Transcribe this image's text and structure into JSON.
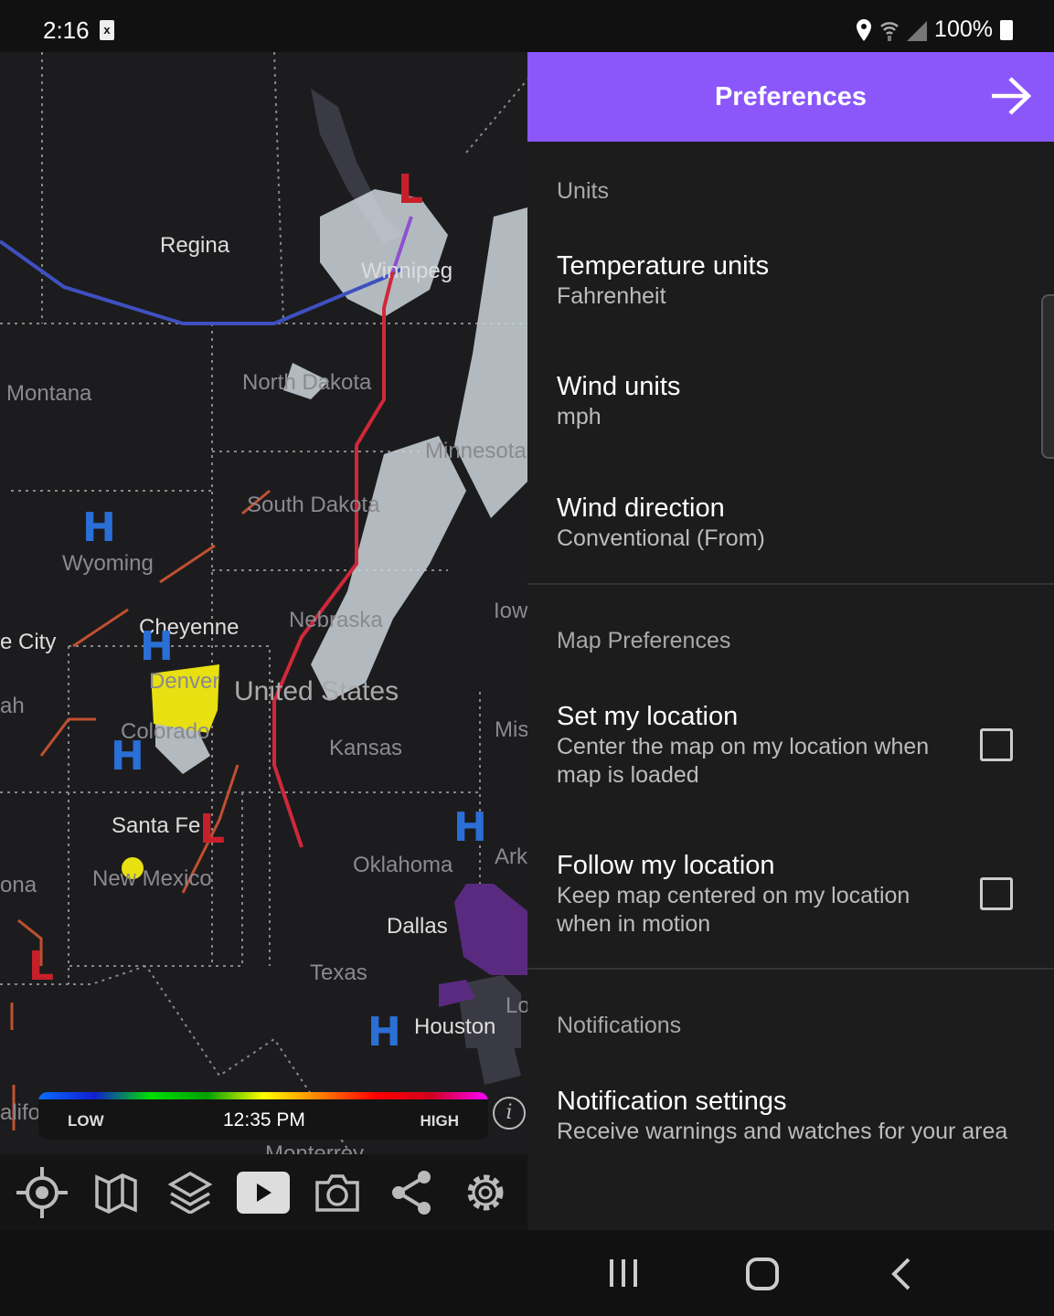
{
  "status_bar": {
    "time": "2:16",
    "battery": "100%",
    "icons": [
      "notification-x-icon",
      "location-icon",
      "wifi-icon",
      "signal-icon",
      "battery-icon"
    ]
  },
  "map": {
    "labels": [
      "Regina",
      "Winnipeg",
      "Montana",
      "North Dakota",
      "Minnesota",
      "South Dakota",
      "Wyoming",
      "Cheyenne",
      "Nebraska",
      "Iowa",
      "e City",
      "ah",
      "Denver",
      "United States",
      "Colorado",
      "Kansas",
      "Mis",
      "Santa Fe",
      "New Mexico",
      "Oklahoma",
      "Ark",
      "ona",
      "Dallas",
      "Texas",
      "Houston",
      "Lo",
      "alifo",
      "Monterrey"
    ],
    "pressure_high": "H",
    "pressure_low": "L",
    "legend": {
      "low": "LOW",
      "time": "12:35 PM",
      "high": "HIGH",
      "colors": [
        "#0a6cff",
        "#00e000",
        "#ffff00",
        "#ff8000",
        "#ff0000",
        "#ff00ff"
      ]
    },
    "info_label": "i"
  },
  "toolbar": {
    "items": [
      "locate-icon",
      "map-icon",
      "layers-icon",
      "play-icon",
      "camera-icon",
      "share-icon",
      "settings-icon"
    ]
  },
  "panel": {
    "title": "Preferences",
    "accent": "#8b57fb",
    "sections": [
      {
        "header": "Units",
        "items": [
          {
            "title": "Temperature units",
            "value": "Fahrenheit"
          },
          {
            "title": "Wind units",
            "value": "mph"
          },
          {
            "title": "Wind direction",
            "value": "Conventional (From)"
          }
        ]
      },
      {
        "header": "Map Preferences",
        "items": [
          {
            "title": "Set my location",
            "value": "Center the map on my location when map is loaded",
            "checked": false
          },
          {
            "title": "Follow my location",
            "value": "Keep map centered on my location when in motion",
            "checked": false
          }
        ]
      },
      {
        "header": "Notifications",
        "items": [
          {
            "title": "Notification settings",
            "value": "Receive warnings and watches for your area"
          }
        ]
      }
    ]
  }
}
